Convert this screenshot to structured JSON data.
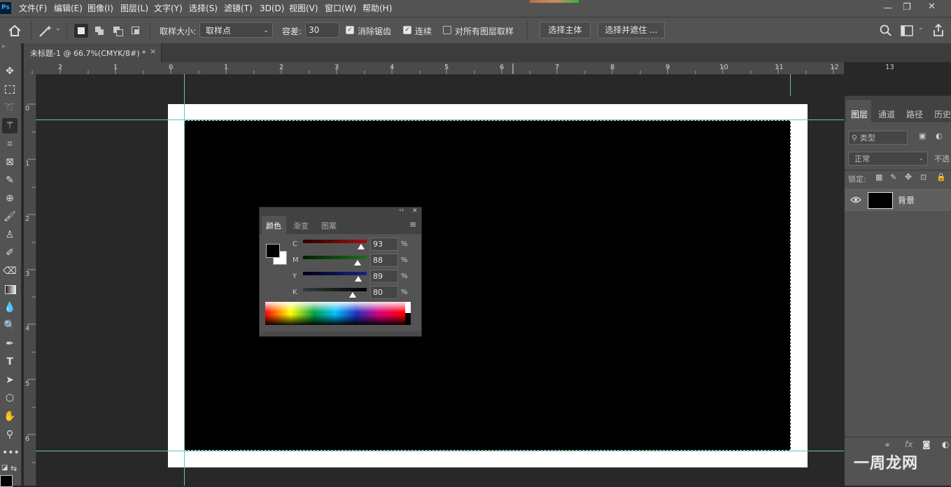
{
  "menubar": {
    "logo": "Ps",
    "items": [
      "文件(F)",
      "编辑(E)",
      "图像(I)",
      "图层(L)",
      "文字(Y)",
      "选择(S)",
      "滤镜(T)",
      "3D(D)",
      "视图(V)",
      "窗口(W)",
      "帮助(H)"
    ],
    "win_minimize": "—",
    "win_restore": "❐",
    "win_close": "✕"
  },
  "options": {
    "sample_size_label": "取样大小:",
    "sample_size_value": "取样点",
    "tolerance_label": "容差:",
    "tolerance_value": "30",
    "anti_alias_label": "消除锯齿",
    "anti_alias_checked": true,
    "contiguous_label": "连续",
    "contiguous_checked": true,
    "all_layers_label": "对所有图层取样",
    "all_layers_checked": false,
    "select_subject": "选择主体",
    "select_and_mask": "选择并遮住 ..."
  },
  "document_tab": {
    "title": "未标题-1 @ 66.7%(CMYK/8#) *",
    "close": "×"
  },
  "rulers": {
    "horizontal": [
      "2",
      "1",
      "0",
      "1",
      "2",
      "3",
      "4",
      "5",
      "6",
      "7",
      "8",
      "9",
      "10",
      "11",
      "12",
      "13"
    ],
    "vertical": [
      "0",
      "1",
      "2",
      "3",
      "4",
      "5",
      "6"
    ]
  },
  "color_panel": {
    "tabs": [
      "颜色",
      "渐变",
      "图案"
    ],
    "active_tab": "颜色",
    "channels": [
      {
        "label": "C",
        "value": "93",
        "unit": "%",
        "color": "#8b1a1a"
      },
      {
        "label": "M",
        "value": "88",
        "unit": "%",
        "color": "#1b5e20"
      },
      {
        "label": "Y",
        "value": "89",
        "unit": "%",
        "color": "#1a237e"
      },
      {
        "label": "K",
        "value": "80",
        "unit": "%",
        "color": "#3a3a3a"
      }
    ],
    "collapse": "‹‹",
    "close": "✕",
    "menu": "≡"
  },
  "layers_panel": {
    "tabs": [
      "图层",
      "通道",
      "路径",
      "历史"
    ],
    "active_tab": "图层",
    "filter_placeholder": "类型",
    "blend_mode": "正常",
    "opacity_label": "不透",
    "lock_label": "锁定:",
    "layers": [
      {
        "name": "背景",
        "visible": true
      }
    ]
  },
  "watermark": "一周龙网"
}
